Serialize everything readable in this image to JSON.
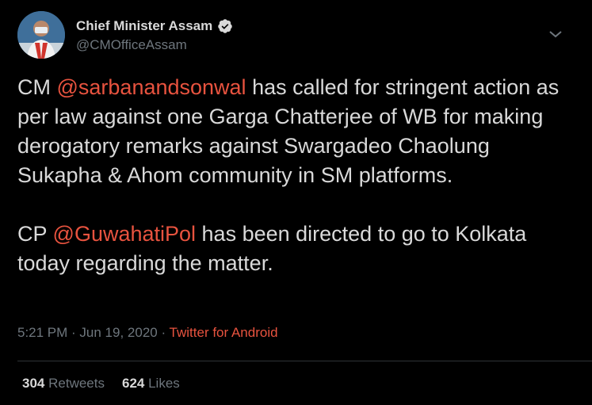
{
  "header": {
    "display_name": "Chief Minister Assam",
    "handle": "@CMOfficeAssam",
    "avatar_icon": "profile-photo",
    "verified_icon": "verified-badge-icon",
    "menu_icon": "chevron-down-icon"
  },
  "tweet": {
    "p1": {
      "t1": "CM ",
      "m1": "@sarbanandsonwal",
      "t2": " has called for stringent action as per law against one Garga Chatterjee of WB for making derogatory remarks against Swargadeo Chaolung Sukapha & Ahom community in SM platforms."
    },
    "p2": {
      "t1": "CP ",
      "m1": "@GuwahatiPol",
      "t2": " has been directed to go to Kolkata today regarding the matter."
    }
  },
  "meta": {
    "time": "5:21 PM",
    "sep1": " · ",
    "date": "Jun 19, 2020",
    "sep2": " · ",
    "source": "Twitter for Android"
  },
  "stats": {
    "retweets_count": "304",
    "retweets_label": "Retweets",
    "likes_count": "624",
    "likes_label": "Likes"
  },
  "colors": {
    "background": "#000000",
    "text": "#d9d9d9",
    "muted": "#6e767d",
    "accent": "#e8533f"
  }
}
